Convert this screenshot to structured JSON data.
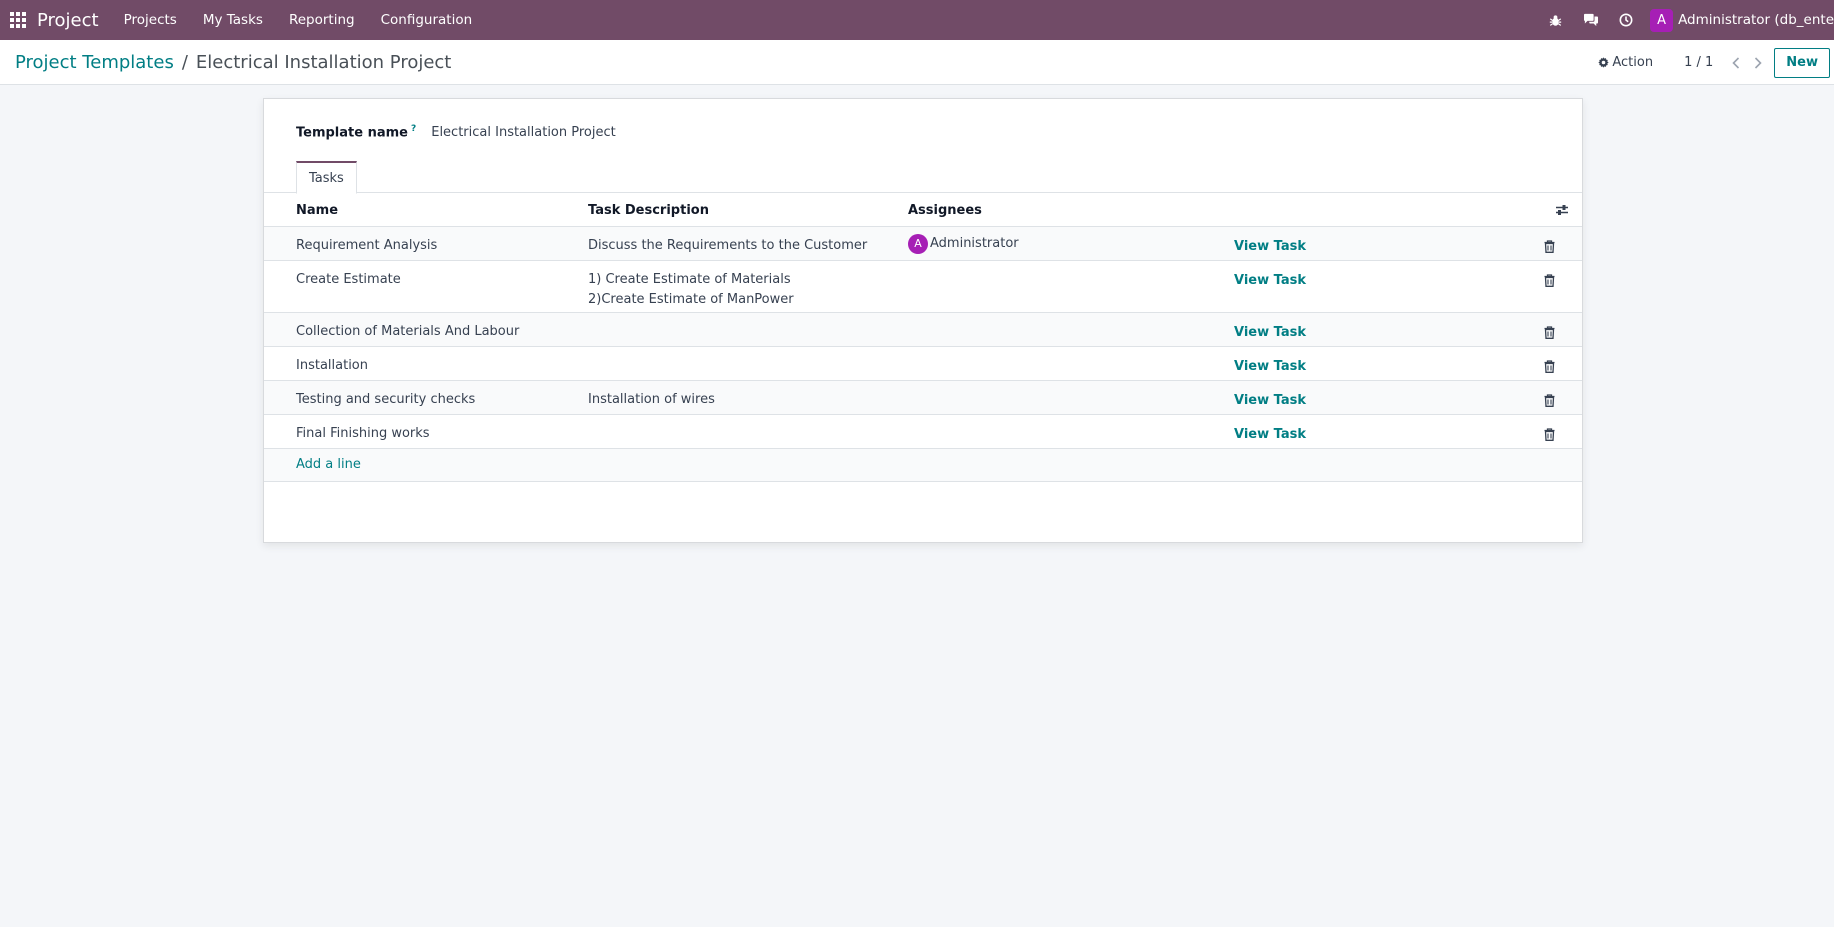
{
  "navbar": {
    "app_name": "Project",
    "menu": [
      "Projects",
      "My Tasks",
      "Reporting",
      "Configuration"
    ],
    "user": {
      "initial": "A",
      "name": "Administrator (db_ente"
    },
    "icons": [
      "apps-grid-icon",
      "bug-icon",
      "chat-icon",
      "clock-icon"
    ]
  },
  "control_panel": {
    "breadcrumb_parent": "Project Templates",
    "breadcrumb_sep": "/",
    "breadcrumb_current": "Electrical Installation Project",
    "action_label": "Action",
    "pager": "1 / 1",
    "new_label": "New"
  },
  "form": {
    "template_name_label": "Template name",
    "help_mark": "?",
    "template_name_value": "Electrical Installation Project",
    "tab_label": "Tasks",
    "columns": {
      "name": "Name",
      "description": "Task Description",
      "assignees": "Assignees"
    },
    "rows": [
      {
        "name": "Requirement Analysis",
        "desc1": "Discuss the Requirements to the Customer",
        "desc2": "",
        "assignee_initial": "A",
        "assignee": "Administrator",
        "view": "View Task"
      },
      {
        "name": "Create Estimate",
        "desc1": "1) Create Estimate of Materials",
        "desc2": "2)Create Estimate of ManPower",
        "assignee_initial": "",
        "assignee": "",
        "view": "View Task"
      },
      {
        "name": "Collection of Materials And Labour",
        "desc1": "",
        "desc2": "",
        "assignee_initial": "",
        "assignee": "",
        "view": "View Task"
      },
      {
        "name": "Installation",
        "desc1": "",
        "desc2": "",
        "assignee_initial": "",
        "assignee": "",
        "view": "View Task"
      },
      {
        "name": "Testing and security checks",
        "desc1": "Installation of wires",
        "desc2": "",
        "assignee_initial": "",
        "assignee": "",
        "view": "View Task"
      },
      {
        "name": "Final Finishing works",
        "desc1": "",
        "desc2": "",
        "assignee_initial": "",
        "assignee": "",
        "view": "View Task"
      }
    ],
    "add_line": "Add a line"
  },
  "colors": {
    "navbar": "#714b67",
    "accent": "#017e84",
    "avatar": "#a61fb5"
  }
}
